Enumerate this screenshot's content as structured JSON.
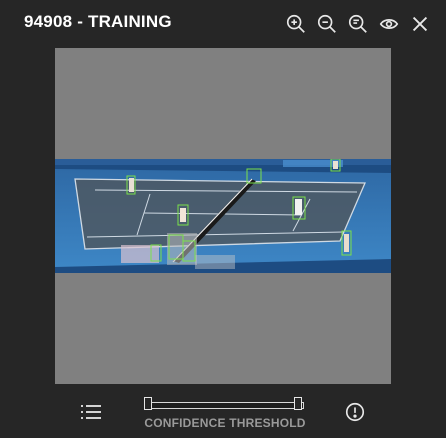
{
  "header": {
    "title": "94908 - TRAINING",
    "tools": [
      {
        "name": "zoom-fit-icon"
      },
      {
        "name": "zoom-out-icon"
      },
      {
        "name": "zoom-in-icon"
      },
      {
        "name": "eye-icon"
      },
      {
        "name": "close-icon"
      }
    ]
  },
  "colors": {
    "background": "#262626",
    "viewer": "#808080",
    "court": "#3d7fb9",
    "box": "#7be14a"
  },
  "footer": {
    "slider_label": "CONFIDENCE THRESHOLD",
    "slider_low": 0.0,
    "slider_high": 1.0,
    "menu_icon": "list-icon",
    "info_icon": "info-icon"
  }
}
